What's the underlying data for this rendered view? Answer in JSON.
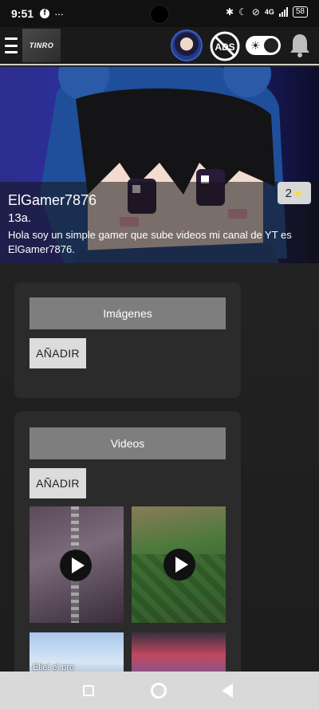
{
  "status_bar": {
    "time": "9:51",
    "left_icons": [
      "facebook-icon",
      "more-dots-icon"
    ],
    "network": "4G",
    "battery": "58"
  },
  "app_bar": {
    "logo_text": "TINRO",
    "ads_label": "ADS"
  },
  "profile": {
    "name": "ElGamer7876",
    "age": "13a.",
    "bio": "Hola soy un simple gamer que sube videos mi canal de YT es ElGamer7876.",
    "rating": "2"
  },
  "images_section": {
    "title": "Imágenes",
    "add_label": "AÑADIR"
  },
  "videos_section": {
    "title": "Videos",
    "add_label": "AÑADIR",
    "thumbnails": [
      {
        "caption": ""
      },
      {
        "caption": ""
      },
      {
        "caption": "Elie! el pro"
      },
      {
        "caption": ""
      }
    ]
  },
  "colors": {
    "banner_blue": "#2e2fa2",
    "panel_bg": "#2b2b2b",
    "section_header": "#7e7e7e",
    "button_bg": "#dcdcdc",
    "star": "#ffd84a"
  }
}
